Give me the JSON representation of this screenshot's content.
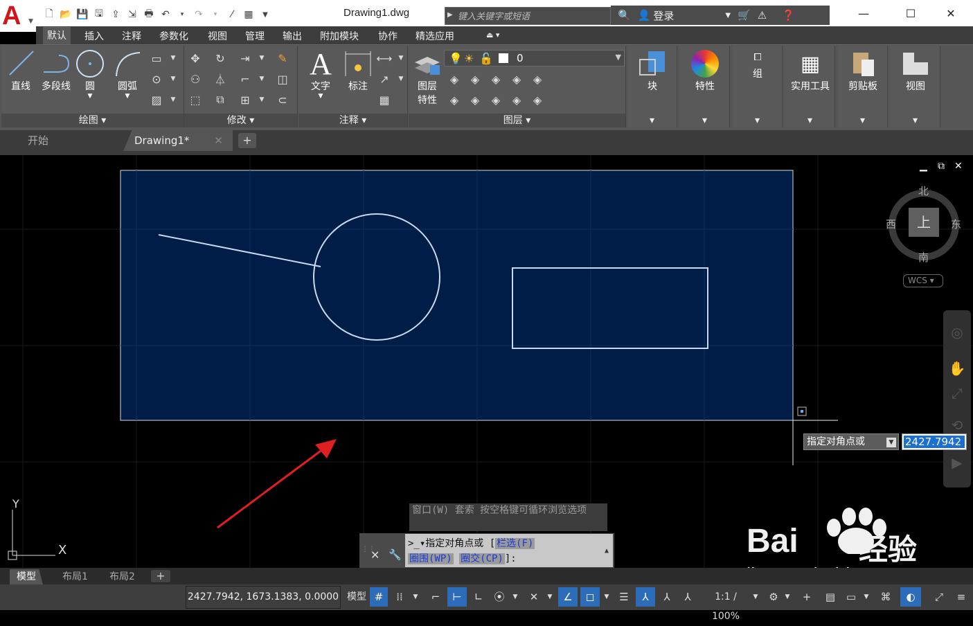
{
  "title_bar": {
    "doc_title": "Drawing1.dwg",
    "search_placeholder": "键入关键字或短语",
    "login_label": "登录"
  },
  "ribbon_tabs": [
    "默认",
    "插入",
    "注释",
    "参数化",
    "视图",
    "管理",
    "输出",
    "附加模块",
    "协作",
    "精选应用"
  ],
  "ribbon": {
    "draw": {
      "title": "绘图",
      "line": "直线",
      "polyline": "多段线",
      "circle": "圆",
      "arc": "圆弧"
    },
    "modify": {
      "title": "修改"
    },
    "annotation": {
      "title": "注释",
      "text": "文字",
      "dimension": "标注"
    },
    "layers": {
      "title": "图层",
      "props_line1": "图层",
      "props_line2": "特性",
      "current_layer": "0"
    },
    "block": "块",
    "properties": "特性",
    "group": "组",
    "utilities": "实用工具",
    "clipboard": "剪贴板",
    "view": "视图"
  },
  "doc_tabs": {
    "start": "开始",
    "drawing": "Drawing1*"
  },
  "viewcube": {
    "north": "北",
    "south": "南",
    "east": "东",
    "west": "西",
    "top": "上",
    "wcs": "WCS"
  },
  "ucs": {
    "x": "X",
    "y": "Y"
  },
  "dynamic_input": {
    "prompt": "指定对角点或",
    "value": "2427.7942"
  },
  "command": {
    "hint": "窗口(W) 套索  按空格键可循环浏览选项",
    "line1_prefix": "指定对角点或 [",
    "opt_fence": "栏选(F)",
    "opt_wpoly": "圈围(WP)",
    "opt_cpoly": "圈交(CP)",
    "line2_suffix": "]:"
  },
  "layout_tabs": [
    "模型",
    "布局1",
    "布局2"
  ],
  "status": {
    "coords": "2427.7942, 1673.1383, 0.0000",
    "model": "模型",
    "scale": "1:1 / 100%"
  },
  "watermark": {
    "brand": "Bai",
    "brand2": "经验",
    "url": "jingyan.baidu.com"
  },
  "colors": {
    "selection_fill": "#001d47",
    "autocad_red": "#d0161b",
    "ribbon": "#595959",
    "highlight_blue": "#2d6cb8"
  }
}
